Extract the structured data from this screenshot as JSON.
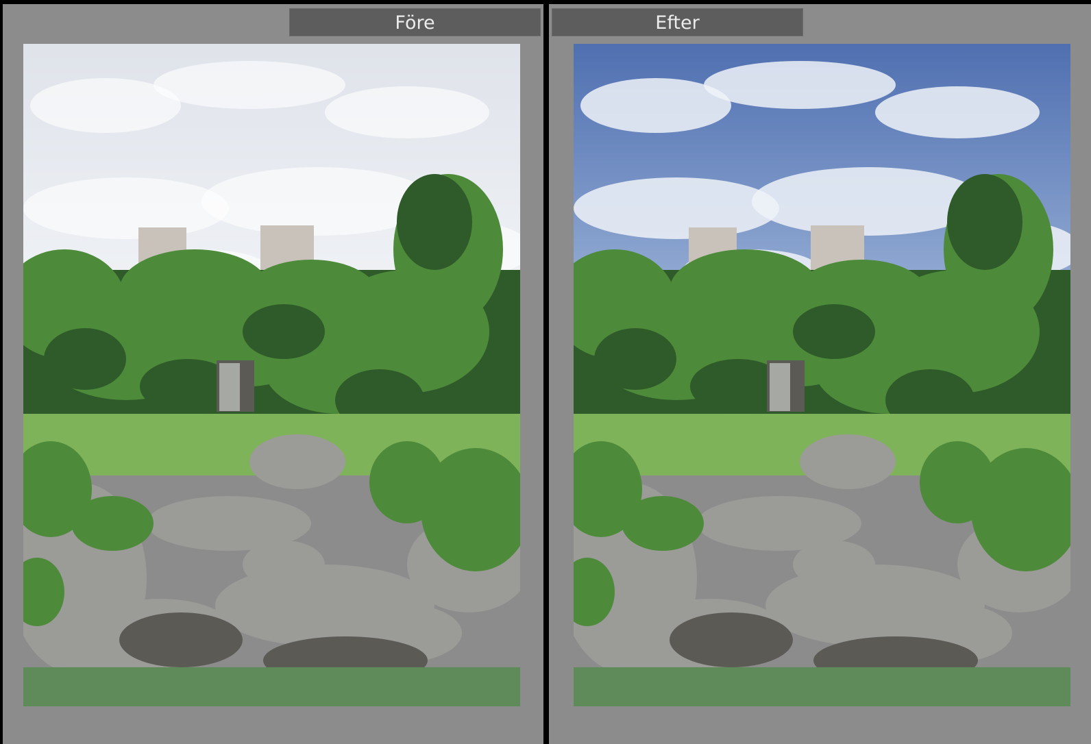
{
  "compare_view": {
    "before": {
      "label": "Före",
      "sky_top": "#dfe3ea",
      "sky_bottom": "#f2f4f7",
      "cloud_color": "#ffffff"
    },
    "after": {
      "label": "Efter",
      "sky_top": "#4f6fb0",
      "sky_bottom": "#9fb6da",
      "cloud_color": "#eef2f8"
    }
  },
  "colors": {
    "panel_bg": "#8c8c8c",
    "header_bg": "#5d5d5d",
    "divider": "#000000",
    "foliage_dark": "#2f5a2a",
    "foliage": "#4d8a3a",
    "foliage_light": "#7fb35a",
    "rock": "#9b9b98",
    "rock_dark": "#5b5a55",
    "water": "#5f8a5a",
    "building": "#c9c2bb"
  }
}
